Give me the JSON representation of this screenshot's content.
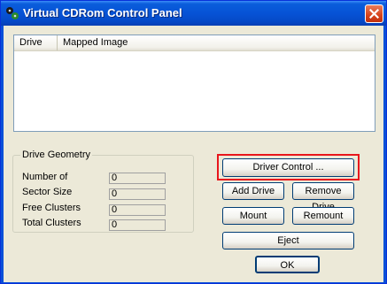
{
  "window": {
    "title": "Virtual CDRom Control Panel",
    "close_glyph": "✕"
  },
  "listview": {
    "columns": [
      "Drive",
      "Mapped Image"
    ]
  },
  "drive_geometry": {
    "title": "Drive Geometry",
    "rows": [
      {
        "label": "Number of",
        "value": "0"
      },
      {
        "label": "Sector Size",
        "value": "0"
      },
      {
        "label": "Free Clusters",
        "value": "0"
      },
      {
        "label": "Total Clusters",
        "value": "0"
      }
    ]
  },
  "buttons": {
    "driver_control": "Driver Control ...",
    "add_drive": "Add Drive",
    "remove_drive": "Remove Drive",
    "mount": "Mount",
    "remount": "Remount",
    "eject": "Eject",
    "ok": "OK"
  },
  "highlight_color": "#e8161c"
}
